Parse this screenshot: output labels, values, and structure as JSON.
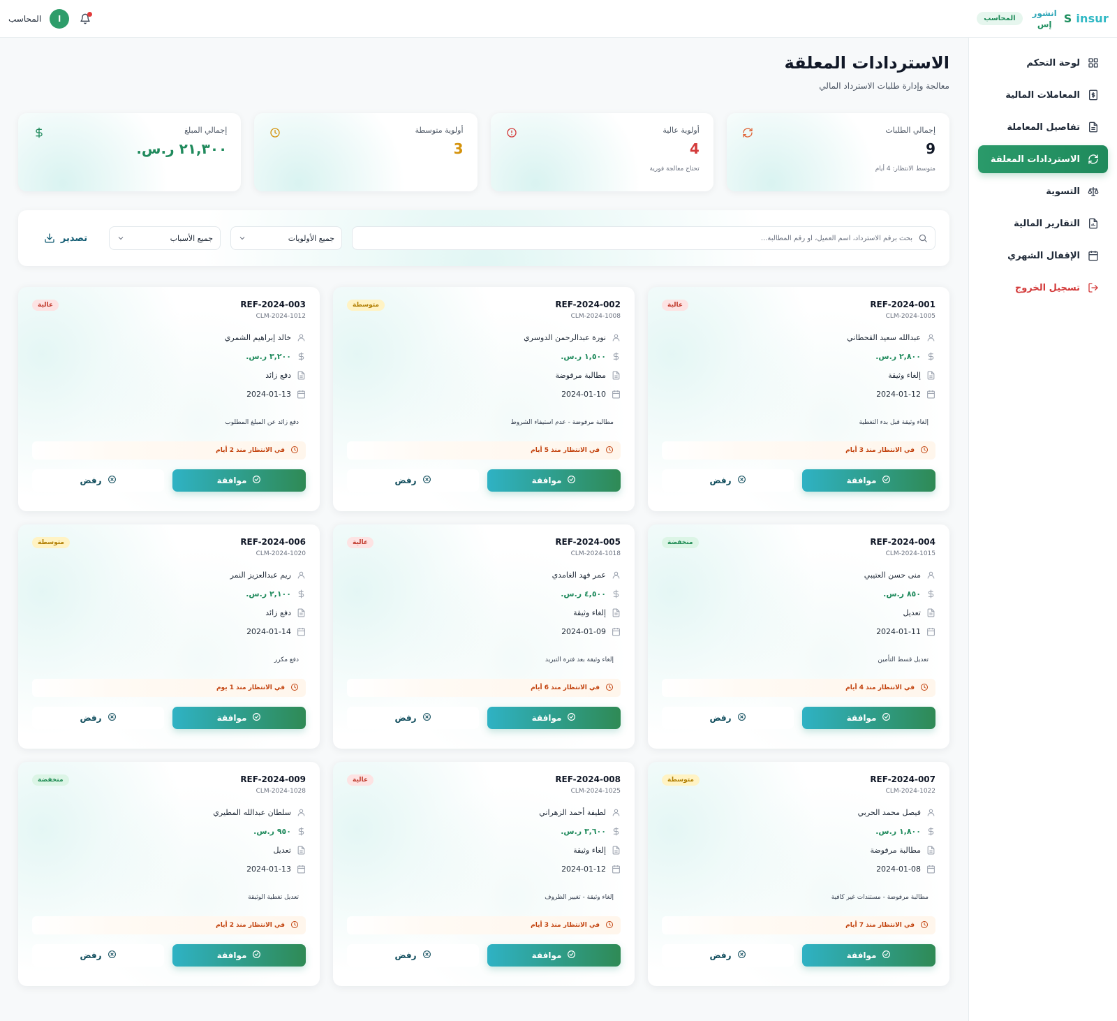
{
  "brand": {
    "logo": "insur",
    "logo_s": "S",
    "ar_line1": "انشور",
    "ar_line2": "إس",
    "role": "المحاسب"
  },
  "header": {
    "user_name": "المحاسب",
    "avatar_initial": "ا"
  },
  "sidebar": {
    "items": [
      {
        "label": "لوحة التحكم",
        "icon": "grid-icon"
      },
      {
        "label": "المعاملات المالية",
        "icon": "dollar-doc-icon"
      },
      {
        "label": "تفاصيل المعاملة",
        "icon": "document-icon"
      },
      {
        "label": "الاستردادات المعلقة",
        "icon": "refresh-icon",
        "active": true
      },
      {
        "label": "التسوية",
        "icon": "scale-icon"
      },
      {
        "label": "التقارير المالية",
        "icon": "report-icon"
      },
      {
        "label": "الإقفال الشهري",
        "icon": "calendar-icon"
      }
    ],
    "logout": "تسجيل الخروج"
  },
  "page": {
    "title": "الاستردادات المعلقة",
    "subtitle": "معالجة وإدارة طلبات الاسترداد المالي"
  },
  "stats": [
    {
      "label": "إجمالي الطلبات",
      "value": "9",
      "note": "متوسط الانتظار: 4 أيام",
      "color": "#111827",
      "icon": "refresh-icon",
      "icon_color": "#e0663a"
    },
    {
      "label": "أولوية عالية",
      "value": "4",
      "note": "تحتاج معالجة فورية",
      "color": "#d33b3b",
      "icon": "alert-icon",
      "icon_color": "#d33b3b"
    },
    {
      "label": "أولوية متوسطة",
      "value": "3",
      "note": "",
      "color": "#d4920b",
      "icon": "clock-icon",
      "icon_color": "#d4920b"
    },
    {
      "label": "إجمالي المبلغ",
      "value": "٢١,٣٠٠ ر.س.",
      "note": "",
      "color": "#1f8a5c",
      "icon": "dollar-icon",
      "icon_color": "#1f8a5c"
    }
  ],
  "filters": {
    "search_placeholder": "بحث برقم الاسترداد، اسم العميل، أو رقم المطالبة...",
    "priority_select": "جميع الأولويات",
    "reason_select": "جميع الأسباب",
    "export_label": "تصدير"
  },
  "colors": {
    "primary": "#1f8a5c",
    "accent": "#2fb2c4",
    "danger": "#d33b3b"
  },
  "refunds": [
    {
      "ref": "REF-2024-001",
      "claim": "CLM-2024-1005",
      "priority": "عالية",
      "level": "high",
      "customer": "عبدالله سعيد القحطاني",
      "amount": "٢,٨٠٠ ر.س.",
      "type": "إلغاء وثيقة",
      "date": "2024-01-12",
      "reason": "إلغاء وثيقة قبل بدء التغطية",
      "pending": "في الانتظار منذ 3 أيام",
      "approve": "موافقة",
      "reject": "رفض"
    },
    {
      "ref": "REF-2024-002",
      "claim": "CLM-2024-1008",
      "priority": "متوسطة",
      "level": "mid",
      "customer": "نورة عبدالرحمن الدوسري",
      "amount": "١,٥٠٠ ر.س.",
      "type": "مطالبة مرفوضة",
      "date": "2024-01-10",
      "reason": "مطالبة مرفوضة - عدم استيفاء الشروط",
      "pending": "في الانتظار منذ 5 أيام",
      "approve": "موافقة",
      "reject": "رفض"
    },
    {
      "ref": "REF-2024-003",
      "claim": "CLM-2024-1012",
      "priority": "عالية",
      "level": "high",
      "customer": "خالد إبراهيم الشمري",
      "amount": "٣,٢٠٠ ر.س.",
      "type": "دفع زائد",
      "date": "2024-01-13",
      "reason": "دفع زائد عن المبلغ المطلوب",
      "pending": "في الانتظار منذ 2 أيام",
      "approve": "موافقة",
      "reject": "رفض"
    },
    {
      "ref": "REF-2024-004",
      "claim": "CLM-2024-1015",
      "priority": "منخفضة",
      "level": "low",
      "customer": "منى حسن العتيبي",
      "amount": "٨٥٠ ر.س.",
      "type": "تعديل",
      "date": "2024-01-11",
      "reason": "تعديل قسط التأمين",
      "pending": "في الانتظار منذ 4 أيام",
      "approve": "موافقة",
      "reject": "رفض"
    },
    {
      "ref": "REF-2024-005",
      "claim": "CLM-2024-1018",
      "priority": "عالية",
      "level": "high",
      "customer": "عمر فهد الغامدي",
      "amount": "٤,٥٠٠ ر.س.",
      "type": "إلغاء وثيقة",
      "date": "2024-01-09",
      "reason": "إلغاء وثيقة بعد فترة التبريد",
      "pending": "في الانتظار منذ 6 أيام",
      "approve": "موافقة",
      "reject": "رفض"
    },
    {
      "ref": "REF-2024-006",
      "claim": "CLM-2024-1020",
      "priority": "متوسطة",
      "level": "mid",
      "customer": "ريم عبدالعزيز النمر",
      "amount": "٢,١٠٠ ر.س.",
      "type": "دفع زائد",
      "date": "2024-01-14",
      "reason": "دفع مكرر",
      "pending": "في الانتظار منذ 1 يوم",
      "approve": "موافقة",
      "reject": "رفض"
    },
    {
      "ref": "REF-2024-007",
      "claim": "CLM-2024-1022",
      "priority": "متوسطة",
      "level": "mid",
      "customer": "فيصل محمد الحربي",
      "amount": "١,٨٠٠ ر.س.",
      "type": "مطالبة مرفوضة",
      "date": "2024-01-08",
      "reason": "مطالبة مرفوضة - مستندات غير كافية",
      "pending": "في الانتظار منذ 7 أيام",
      "approve": "موافقة",
      "reject": "رفض"
    },
    {
      "ref": "REF-2024-008",
      "claim": "CLM-2024-1025",
      "priority": "عالية",
      "level": "high",
      "customer": "لطيفة أحمد الزهراني",
      "amount": "٣,٦٠٠ ر.س.",
      "type": "إلغاء وثيقة",
      "date": "2024-01-12",
      "reason": "إلغاء وثيقة - تغيير الظروف",
      "pending": "في الانتظار منذ 3 أيام",
      "approve": "موافقة",
      "reject": "رفض"
    },
    {
      "ref": "REF-2024-009",
      "claim": "CLM-2024-1028",
      "priority": "منخفضة",
      "level": "low",
      "customer": "سلطان عبدالله المطيري",
      "amount": "٩٥٠ ر.س.",
      "type": "تعديل",
      "date": "2024-01-13",
      "reason": "تعديل تغطية الوثيقة",
      "pending": "في الانتظار منذ 2 أيام",
      "approve": "موافقة",
      "reject": "رفض"
    }
  ]
}
